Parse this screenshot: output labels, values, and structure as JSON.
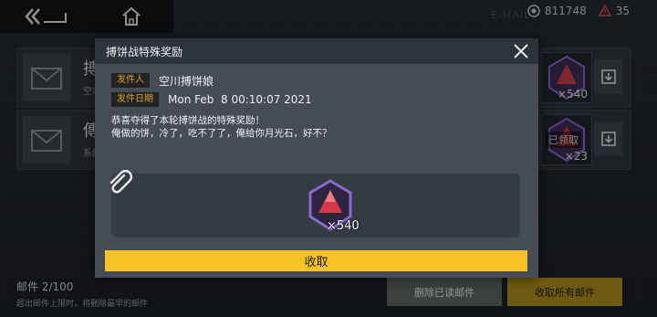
{
  "topbar": {
    "currency_amount": "811748",
    "energy_amount": "35",
    "faint_caption": "E-MAIL"
  },
  "mail_list": [
    {
      "title": "搏",
      "sub": "空川",
      "reward_count": "×540",
      "date": "2021-02-08",
      "claimed_label": ""
    },
    {
      "title": "傳",
      "sub": "系统",
      "reward_count": "×23",
      "date": "",
      "claimed_label": "已领取"
    }
  ],
  "footer": {
    "mail_count": "邮件 2/100",
    "note": "超出邮件上限时，将删除最早的邮件",
    "delete_read_label": "删除已读邮件",
    "claim_all_label": "收取所有邮件"
  },
  "dialog": {
    "title": "搏饼战特殊奖励",
    "sender_label": "发件人",
    "sender": "空川搏饼娘",
    "date_label": "发件日期",
    "date": "Mon Feb  8 00:10:07 2021",
    "message_line1": "恭喜夺得了本轮搏饼战的特殊奖励！",
    "message_line2": "俺做的饼，冷了，吃不了了，俺给你月光石，好不？",
    "attachment_count": "×540",
    "claim_label": "收取"
  },
  "colors": {
    "accent_yellow": "#f6c225",
    "label_gold": "#d8a12d",
    "crystal_purple": "#8a6ad0",
    "crystal_red": "#d63a4a"
  },
  "icons": [
    "back-icon",
    "home-icon",
    "currency-icon",
    "energy-icon",
    "close-icon",
    "paperclip-icon",
    "envelope-icon",
    "download-icon",
    "moonstone-crystal-icon"
  ]
}
